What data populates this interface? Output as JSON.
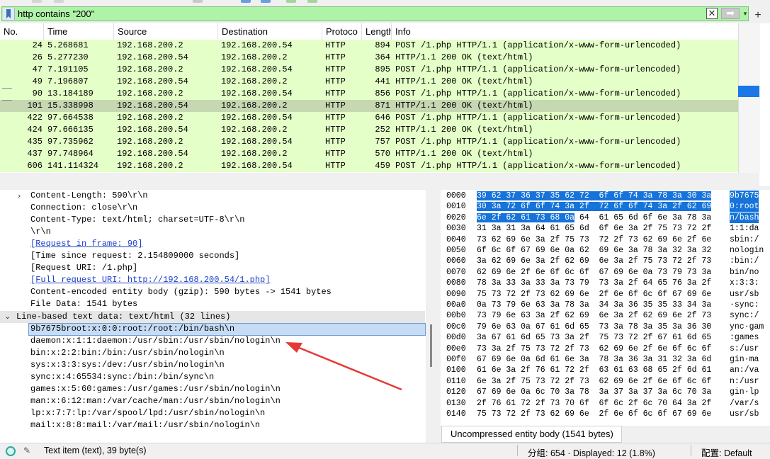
{
  "filter": {
    "value": "http contains \"200\"",
    "clear_symbol": "✕",
    "apply_symbol": "➡",
    "dropdown_symbol": "▾",
    "add_symbol": "+"
  },
  "columns": [
    "No.",
    "Time",
    "Source",
    "Destination",
    "Protoco",
    "Length",
    "Info"
  ],
  "packets": [
    {
      "no": "24",
      "time": "5.268681",
      "src": "192.168.200.2",
      "dst": "192.168.200.54",
      "proto": "HTTP",
      "len": "894",
      "info": "POST /1.php HTTP/1.1  (application/x-www-form-urlencoded)"
    },
    {
      "no": "26",
      "time": "5.277230",
      "src": "192.168.200.54",
      "dst": "192.168.200.2",
      "proto": "HTTP",
      "len": "364",
      "info": "HTTP/1.1 200 OK  (text/html)"
    },
    {
      "no": "47",
      "time": "7.191105",
      "src": "192.168.200.2",
      "dst": "192.168.200.54",
      "proto": "HTTP",
      "len": "895",
      "info": "POST /1.php HTTP/1.1  (application/x-www-form-urlencoded)"
    },
    {
      "no": "49",
      "time": "7.196807",
      "src": "192.168.200.54",
      "dst": "192.168.200.2",
      "proto": "HTTP",
      "len": "441",
      "info": "HTTP/1.1 200 OK  (text/html)"
    },
    {
      "no": "90",
      "time": "13.184189",
      "src": "192.168.200.2",
      "dst": "192.168.200.54",
      "proto": "HTTP",
      "len": "856",
      "info": "POST /1.php HTTP/1.1  (application/x-www-form-urlencoded)"
    },
    {
      "no": "101",
      "time": "15.338998",
      "src": "192.168.200.54",
      "dst": "192.168.200.2",
      "proto": "HTTP",
      "len": "871",
      "info": "HTTP/1.1 200 OK  (text/html)"
    },
    {
      "no": "422",
      "time": "97.664538",
      "src": "192.168.200.2",
      "dst": "192.168.200.54",
      "proto": "HTTP",
      "len": "646",
      "info": "POST /1.php HTTP/1.1  (application/x-www-form-urlencoded)"
    },
    {
      "no": "424",
      "time": "97.666135",
      "src": "192.168.200.54",
      "dst": "192.168.200.2",
      "proto": "HTTP",
      "len": "252",
      "info": "HTTP/1.1 200 OK  (text/html)"
    },
    {
      "no": "435",
      "time": "97.735962",
      "src": "192.168.200.2",
      "dst": "192.168.200.54",
      "proto": "HTTP",
      "len": "757",
      "info": "POST /1.php HTTP/1.1  (application/x-www-form-urlencoded)"
    },
    {
      "no": "437",
      "time": "97.748964",
      "src": "192.168.200.54",
      "dst": "192.168.200.2",
      "proto": "HTTP",
      "len": "570",
      "info": "HTTP/1.1 200 OK  (text/html)"
    },
    {
      "no": "606",
      "time": "141.114324",
      "src": "192.168.200.2",
      "dst": "192.168.200.54",
      "proto": "HTTP",
      "len": "459",
      "info": "POST /1.php HTTP/1.1  (application/x-www-form-urlencoded)"
    }
  ],
  "details": {
    "content_length": "Content-Length: 590\\r\\n",
    "connection": "Connection: close\\r\\n",
    "content_type": "Content-Type: text/html; charset=UTF-8\\r\\n",
    "crlf": "\\r\\n",
    "request_in_frame": "[Request in frame: 90]",
    "time_since": "[Time since request: 2.154809000 seconds]",
    "request_uri": "[Request URI: /1.php]",
    "full_uri": "[Full request URI: http://192.168.200.54/1.php]",
    "content_encoded": "Content-encoded entity body (gzip): 590 bytes -> 1541 bytes",
    "file_data": "File Data: 1541 bytes",
    "line_based": "Line-based text data: text/html (32 lines)",
    "lines": [
      "9b7675broot:x:0:0:root:/root:/bin/bash\\n",
      "daemon:x:1:1:daemon:/usr/sbin:/usr/sbin/nologin\\n",
      "bin:x:2:2:bin:/bin:/usr/sbin/nologin\\n",
      "sys:x:3:3:sys:/dev:/usr/sbin/nologin\\n",
      "sync:x:4:65534:sync:/bin:/bin/sync\\n",
      "games:x:5:60:games:/usr/games:/usr/sbin/nologin\\n",
      "man:x:6:12:man:/var/cache/man:/usr/sbin/nologin\\n",
      "lp:x:7:7:lp:/var/spool/lpd:/usr/sbin/nologin\\n",
      "mail:x:8:8:mail:/var/mail:/usr/sbin/nologin\\n"
    ]
  },
  "bytes": [
    {
      "off": "0000",
      "hex": "39 62 37 36 37 35 62 72  6f 6f 74 3a 78 3a 30 3a",
      "asc": "9b7675"
    },
    {
      "off": "0010",
      "hex": "30 3a 72 6f 6f 74 3a 2f  72 6f 6f 74 3a 2f 62 69",
      "asc": "0:root"
    },
    {
      "off": "0020",
      "hex": "6e 2f 62 61 73 68 0a",
      "hex_rest": " 64  61 65 6d 6f 6e 3a 78 3a",
      "asc": "n/bash"
    },
    {
      "off": "0030",
      "hex": "31 3a 31 3a 64 61 65 6d  6f 6e 3a 2f 75 73 72 2f",
      "asc": "1:1:da"
    },
    {
      "off": "0040",
      "hex": "73 62 69 6e 3a 2f 75 73  72 2f 73 62 69 6e 2f 6e",
      "asc": "sbin:/"
    },
    {
      "off": "0050",
      "hex": "6f 6c 6f 67 69 6e 0a 62  69 6e 3a 78 3a 32 3a 32",
      "asc": "nologin"
    },
    {
      "off": "0060",
      "hex": "3a 62 69 6e 3a 2f 62 69  6e 3a 2f 75 73 72 2f 73",
      "asc": ":bin:/"
    },
    {
      "off": "0070",
      "hex": "62 69 6e 2f 6e 6f 6c 6f  67 69 6e 0a 73 79 73 3a",
      "asc": "bin/no"
    },
    {
      "off": "0080",
      "hex": "78 3a 33 3a 33 3a 73 79  73 3a 2f 64 65 76 3a 2f",
      "asc": "x:3:3:"
    },
    {
      "off": "0090",
      "hex": "75 73 72 2f 73 62 69 6e  2f 6e 6f 6c 6f 67 69 6e",
      "asc": "usr/sb"
    },
    {
      "off": "00a0",
      "hex": "0a 73 79 6e 63 3a 78 3a  34 3a 36 35 35 33 34 3a",
      "asc": "·sync:"
    },
    {
      "off": "00b0",
      "hex": "73 79 6e 63 3a 2f 62 69  6e 3a 2f 62 69 6e 2f 73",
      "asc": "sync:/"
    },
    {
      "off": "00c0",
      "hex": "79 6e 63 0a 67 61 6d 65  73 3a 78 3a 35 3a 36 30",
      "asc": "ync·gam"
    },
    {
      "off": "00d0",
      "hex": "3a 67 61 6d 65 73 3a 2f  75 73 72 2f 67 61 6d 65",
      "asc": ":games"
    },
    {
      "off": "00e0",
      "hex": "73 3a 2f 75 73 72 2f 73  62 69 6e 2f 6e 6f 6c 6f",
      "asc": "s:/usr"
    },
    {
      "off": "00f0",
      "hex": "67 69 6e 0a 6d 61 6e 3a  78 3a 36 3a 31 32 3a 6d",
      "asc": "gin·ma"
    },
    {
      "off": "0100",
      "hex": "61 6e 3a 2f 76 61 72 2f  63 61 63 68 65 2f 6d 61",
      "asc": "an:/va"
    },
    {
      "off": "0110",
      "hex": "6e 3a 2f 75 73 72 2f 73  62 69 6e 2f 6e 6f 6c 6f",
      "asc": "n:/usr"
    },
    {
      "off": "0120",
      "hex": "67 69 6e 0a 6c 70 3a 78  3a 37 3a 37 3a 6c 70 3a",
      "asc": "gin·lp"
    },
    {
      "off": "0130",
      "hex": "2f 76 61 72 2f 73 70 6f  6f 6c 2f 6c 70 64 3a 2f",
      "asc": "/var/s"
    },
    {
      "off": "0140",
      "hex": "75 73 72 2f 73 62 69 6e  2f 6e 6f 6c 6f 67 69 6e",
      "asc": "usr/sb"
    }
  ],
  "bytes_tab": "Uncompressed entity body (1541 bytes)",
  "status": {
    "field": "Text item (text), 39 byte(s)",
    "packets": "分组: 654 · Displayed: 12 (1.8%)",
    "profile": "配置: Default"
  },
  "colors": {
    "row_http": "#e4ffc7",
    "row_selected": "#c5d8b2",
    "filter_ok": "#aff3a8",
    "byte_selection": "#1573da",
    "annotation_arrow": "#e53935"
  },
  "icons": {
    "bookmark": "bookmark-icon",
    "clear": "clear-icon",
    "apply": "apply-arrow-icon",
    "add": "plus-icon",
    "expand": "expand-icon",
    "collapse": "collapse-icon",
    "status": "status-ready-icon",
    "edit": "edit-comment-icon"
  }
}
